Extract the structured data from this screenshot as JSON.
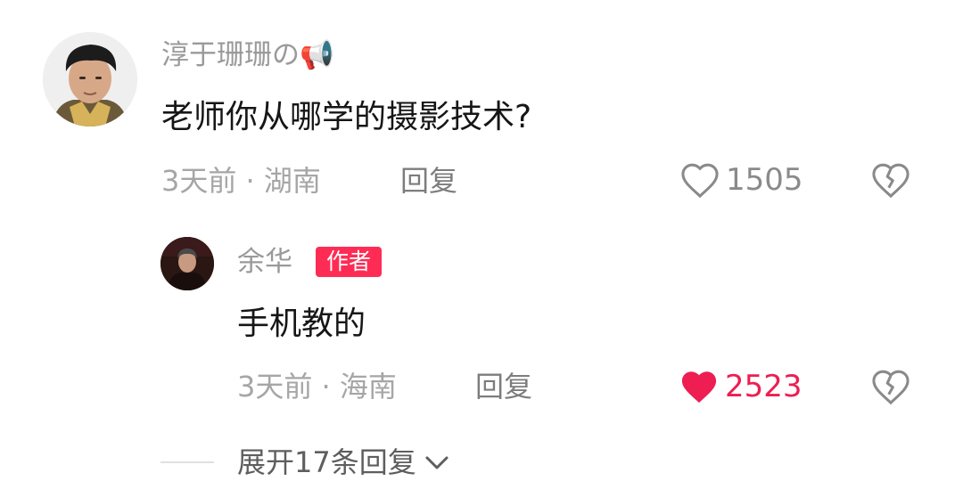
{
  "colors": {
    "accent": "#fe2c55",
    "muted_text": "#a6a6a6",
    "username": "#9a9a9a",
    "body_text": "#161616",
    "like_active": "#ee1d52",
    "like_inactive": "#888888"
  },
  "comment": {
    "username": "淳于珊珊の📢",
    "text": "老师你从哪学的摄影技术?",
    "meta": "3天前 · 湖南",
    "reply_label": "回复",
    "likes": "1505",
    "liked": false,
    "like_icon": "heart-outline-icon",
    "dislike_icon": "broken-heart-icon"
  },
  "reply": {
    "username": "余华",
    "badge": "作者",
    "text": "手机教的",
    "meta": "3天前 · 海南",
    "reply_label": "回复",
    "likes": "2523",
    "liked": true,
    "like_icon": "heart-filled-icon",
    "dislike_icon": "broken-heart-icon"
  },
  "expand": {
    "label": "展开17条回复",
    "icon": "chevron-down-icon"
  }
}
